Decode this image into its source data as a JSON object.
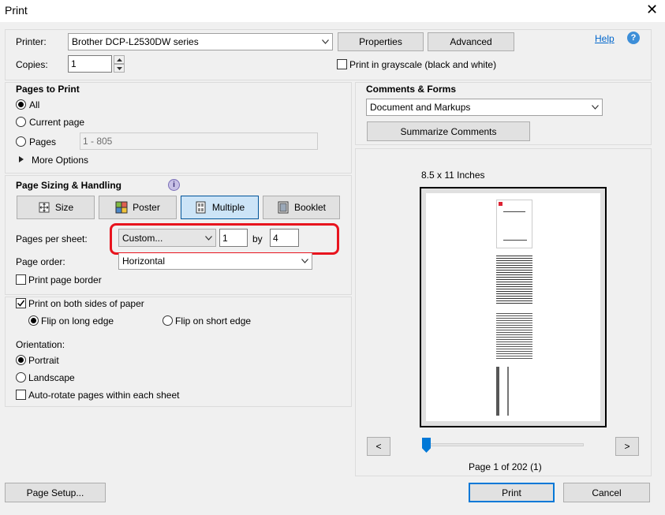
{
  "window": {
    "title": "Print"
  },
  "printer": {
    "label": "Printer:",
    "selected": "Brother DCP-L2530DW series",
    "properties_label": "Properties",
    "advanced_label": "Advanced",
    "help_label": "Help"
  },
  "copies": {
    "label": "Copies:",
    "value": "1"
  },
  "grayscale": {
    "label": "Print in grayscale (black and white)",
    "checked": false
  },
  "pages_to_print": {
    "heading": "Pages to Print",
    "all_label": "All",
    "current_label": "Current page",
    "pages_label": "Pages",
    "pages_value": "1 - 805",
    "more_options_label": "More Options",
    "selected": "All"
  },
  "sizing": {
    "heading": "Page Sizing & Handling",
    "tabs": [
      {
        "label": "Size"
      },
      {
        "label": "Poster"
      },
      {
        "label": "Multiple"
      },
      {
        "label": "Booklet"
      }
    ],
    "active_tab": "Multiple",
    "pages_per_sheet_label": "Pages per sheet:",
    "pages_per_sheet_value": "Custom...",
    "cols_value": "1",
    "by_label": "by",
    "rows_value": "4",
    "page_order_label": "Page order:",
    "page_order_value": "Horizontal",
    "print_border_label": "Print page border",
    "highlight_color": "#e8141e"
  },
  "duplex": {
    "both_sides_label": "Print on both sides of paper",
    "both_sides_checked": true,
    "long_edge_label": "Flip on long edge",
    "short_edge_label": "Flip on short edge",
    "selected_flip": "long"
  },
  "orientation": {
    "heading": "Orientation:",
    "portrait_label": "Portrait",
    "landscape_label": "Landscape",
    "selected": "Portrait",
    "auto_rotate_label": "Auto-rotate pages within each sheet"
  },
  "comments_forms": {
    "heading": "Comments & Forms",
    "selected": "Document and Markups",
    "summarize_label": "Summarize Comments"
  },
  "preview": {
    "paper_size": "8.5 x 11 Inches",
    "prev_label": "<",
    "next_label": ">",
    "page_info": "Page 1 of 202 (1)",
    "slider_position": 0
  },
  "footer": {
    "page_setup_label": "Page Setup...",
    "print_label": "Print",
    "cancel_label": "Cancel"
  },
  "colors": {
    "accent": "#0078d7",
    "link": "#0066cc",
    "help_icon": "#3c8ed8"
  }
}
